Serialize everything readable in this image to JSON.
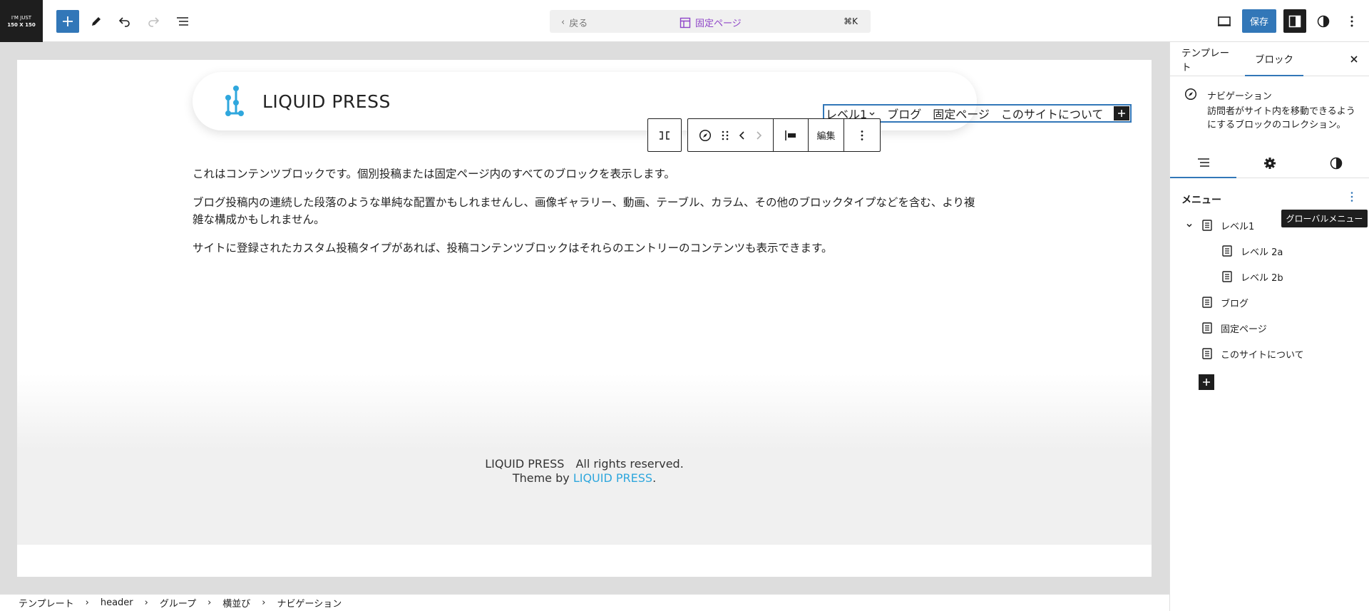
{
  "site_icon": {
    "line1": "I'M JUST",
    "line2": "150 X 150"
  },
  "command_center": {
    "back": "戻る",
    "title": "固定ページ",
    "shortcut": "⌘K"
  },
  "toolbar": {
    "save": "保存"
  },
  "header": {
    "brand": "LIQUID PRESS"
  },
  "navigation": {
    "items": [
      "レベル1",
      "ブログ",
      "固定ページ",
      "このサイトについて"
    ]
  },
  "block_toolbar": {
    "edit": "編集"
  },
  "content": {
    "paragraphs": [
      "これはコンテンツブロックです。個別投稿または固定ページ内のすべてのブロックを表示します。",
      "ブログ投稿内の連続した段落のような単純な配置かもしれませんし、画像ギャラリー、動画、テーブル、カラム、その他のブロックタイプなどを含む、より複雑な構成かもしれません。",
      "サイトに登録されたカスタム投稿タイプがあれば、投稿コンテンツブロックはそれらのエントリーのコンテンツも表示できます。"
    ]
  },
  "footer": {
    "copyright": "LIQUID PRESS　All rights reserved.",
    "theme_by": "Theme by ",
    "link": "LIQUID PRESS",
    "period": "."
  },
  "breadcrumbs": [
    "テンプレート",
    "header",
    "グループ",
    "横並び",
    "ナビゲーション"
  ],
  "sidebar": {
    "tabs": [
      "テンプレート",
      "ブロック"
    ],
    "block_title": "ナビゲーション",
    "block_desc": "訪問者がサイト内を移動できるようにするブロックのコレクション。",
    "menu_heading": "メニュー",
    "tooltip": "グローバルメニュー",
    "tree": [
      {
        "label": "レベル1",
        "expanded": true
      },
      {
        "label": "レベル 2a"
      },
      {
        "label": "レベル 2b"
      },
      {
        "label": "ブログ"
      },
      {
        "label": "固定ページ"
      },
      {
        "label": "このサイトについて"
      }
    ]
  },
  "colors": {
    "accent": "#3277b8",
    "brand": "#2fa7dd",
    "template": "#8e44c8",
    "dark": "#1e1e1e"
  }
}
